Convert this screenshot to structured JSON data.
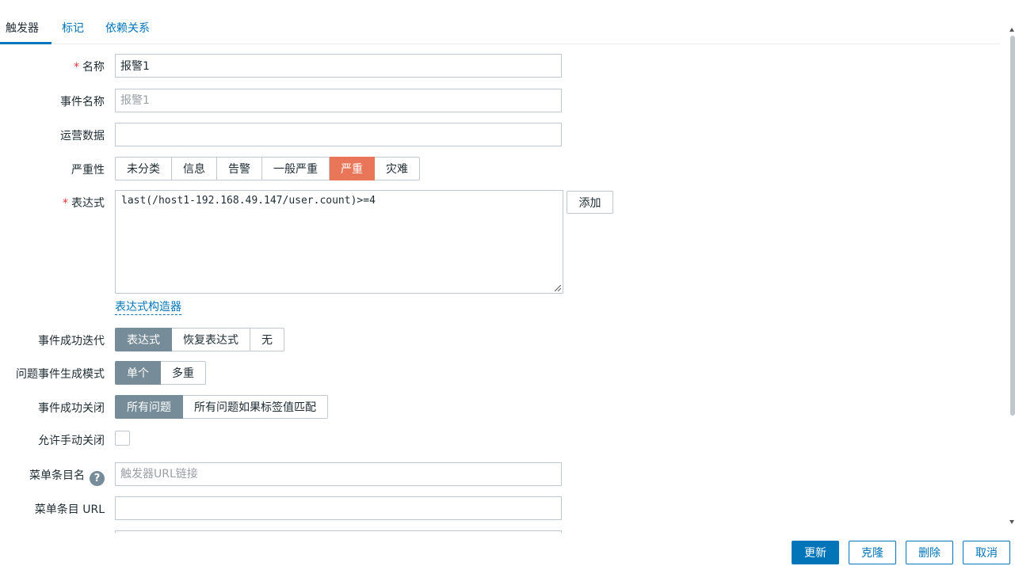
{
  "tabs": [
    {
      "label": "触发器",
      "active": true
    },
    {
      "label": "标记",
      "active": false
    },
    {
      "label": "依赖关系",
      "active": false
    }
  ],
  "form": {
    "name": {
      "label": "名称",
      "value": "报警1",
      "required": true
    },
    "event_name": {
      "label": "事件名称",
      "value": "",
      "placeholder": "报警1"
    },
    "opdata": {
      "label": "运营数据",
      "value": ""
    },
    "severity": {
      "label": "严重性",
      "options": [
        "未分类",
        "信息",
        "告警",
        "一般严重",
        "严重",
        "灾难"
      ],
      "selected": "严重"
    },
    "expression": {
      "label": "表达式",
      "required": true,
      "value": "last(/host1-192.168.49.147/user.count)>=4",
      "add_label": "添加",
      "constructor_link": "表达式构造器"
    },
    "ok_event_generation": {
      "label": "事件成功迭代",
      "options": [
        "表达式",
        "恢复表达式",
        "无"
      ],
      "selected": "表达式"
    },
    "problem_mode": {
      "label": "问题事件生成模式",
      "options": [
        "单个",
        "多重"
      ],
      "selected": "单个"
    },
    "ok_event_closes": {
      "label": "事件成功关闭",
      "options": [
        "所有问题",
        "所有问题如果标签值匹配"
      ],
      "selected": "所有问题"
    },
    "manual_close": {
      "label": "允许手动关闭",
      "checked": false
    },
    "url_name": {
      "label": "菜单条目名",
      "help_icon": "?",
      "value": "",
      "placeholder": "触发器URL链接"
    },
    "url": {
      "label": "菜单条目 URL",
      "value": ""
    }
  },
  "footer": {
    "update": "更新",
    "clone": "克隆",
    "delete": "删除",
    "cancel": "取消"
  },
  "colors": {
    "accent": "#0275b8",
    "severity_high": "#e97659",
    "selected_gray": "#768d99",
    "required": "#e33734"
  }
}
